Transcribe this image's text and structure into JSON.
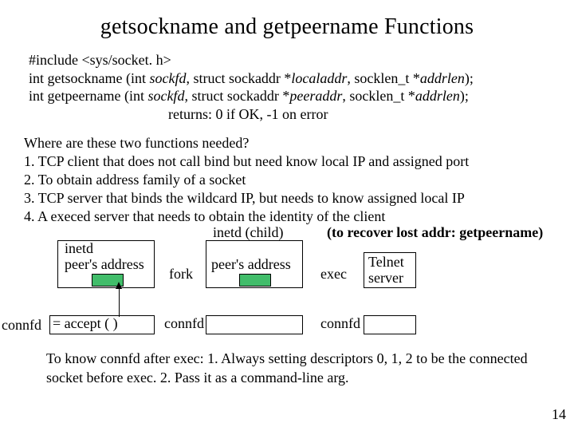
{
  "title": "getsockname and getpeername Functions",
  "sig": {
    "include": "#include <sys/socket. h>",
    "line1a": "int getsockname (int ",
    "line1b": "sockfd",
    "line1c": ", struct sockaddr *",
    "line1d": "localaddr",
    "line1e": ", socklen_t *",
    "line1f": "addrlen",
    "line1g": ");",
    "line2a": "int getpeername (int ",
    "line2b": "sockfd",
    "line2c": ", struct sockaddr *",
    "line2d": "peeraddr",
    "line2e": ", socklen_t *",
    "line2f": "addrlen",
    "line2g": ");",
    "returns": "returns: 0 if OK, -1 on error"
  },
  "q_intro": "Where are these two functions needed?",
  "q1": "1. TCP client that does not call bind but need know local IP and assigned port",
  "q2": "2. To obtain address family of a socket",
  "q3": "3. TCP server that binds the wildcard IP, but needs to know assigned local IP",
  "q4a": "4. A ",
  "q4b": "exec",
  "q4c": "ed server that needs to obtain the identity of the client",
  "dg": {
    "inetd": "inetd",
    "peer_addr": "peer's address",
    "fork": "fork",
    "child": "inetd (child)",
    "recover": "(to recover lost addr: getpeername)",
    "exec": "exec",
    "telnet1": "Telnet",
    "telnet2": "server",
    "connfd_lhs": "connfd",
    "accept": " = accept (    )",
    "connfd1": "connfd",
    "connfd2": "connfd"
  },
  "concl_a": "To know ",
  "concl_b": "connfd",
  "concl_c": " after exec: 1. Always setting descriptors 0, 1, 2 to be the connected socket before exec. 2. Pass it as a command-line arg.",
  "page": "14"
}
